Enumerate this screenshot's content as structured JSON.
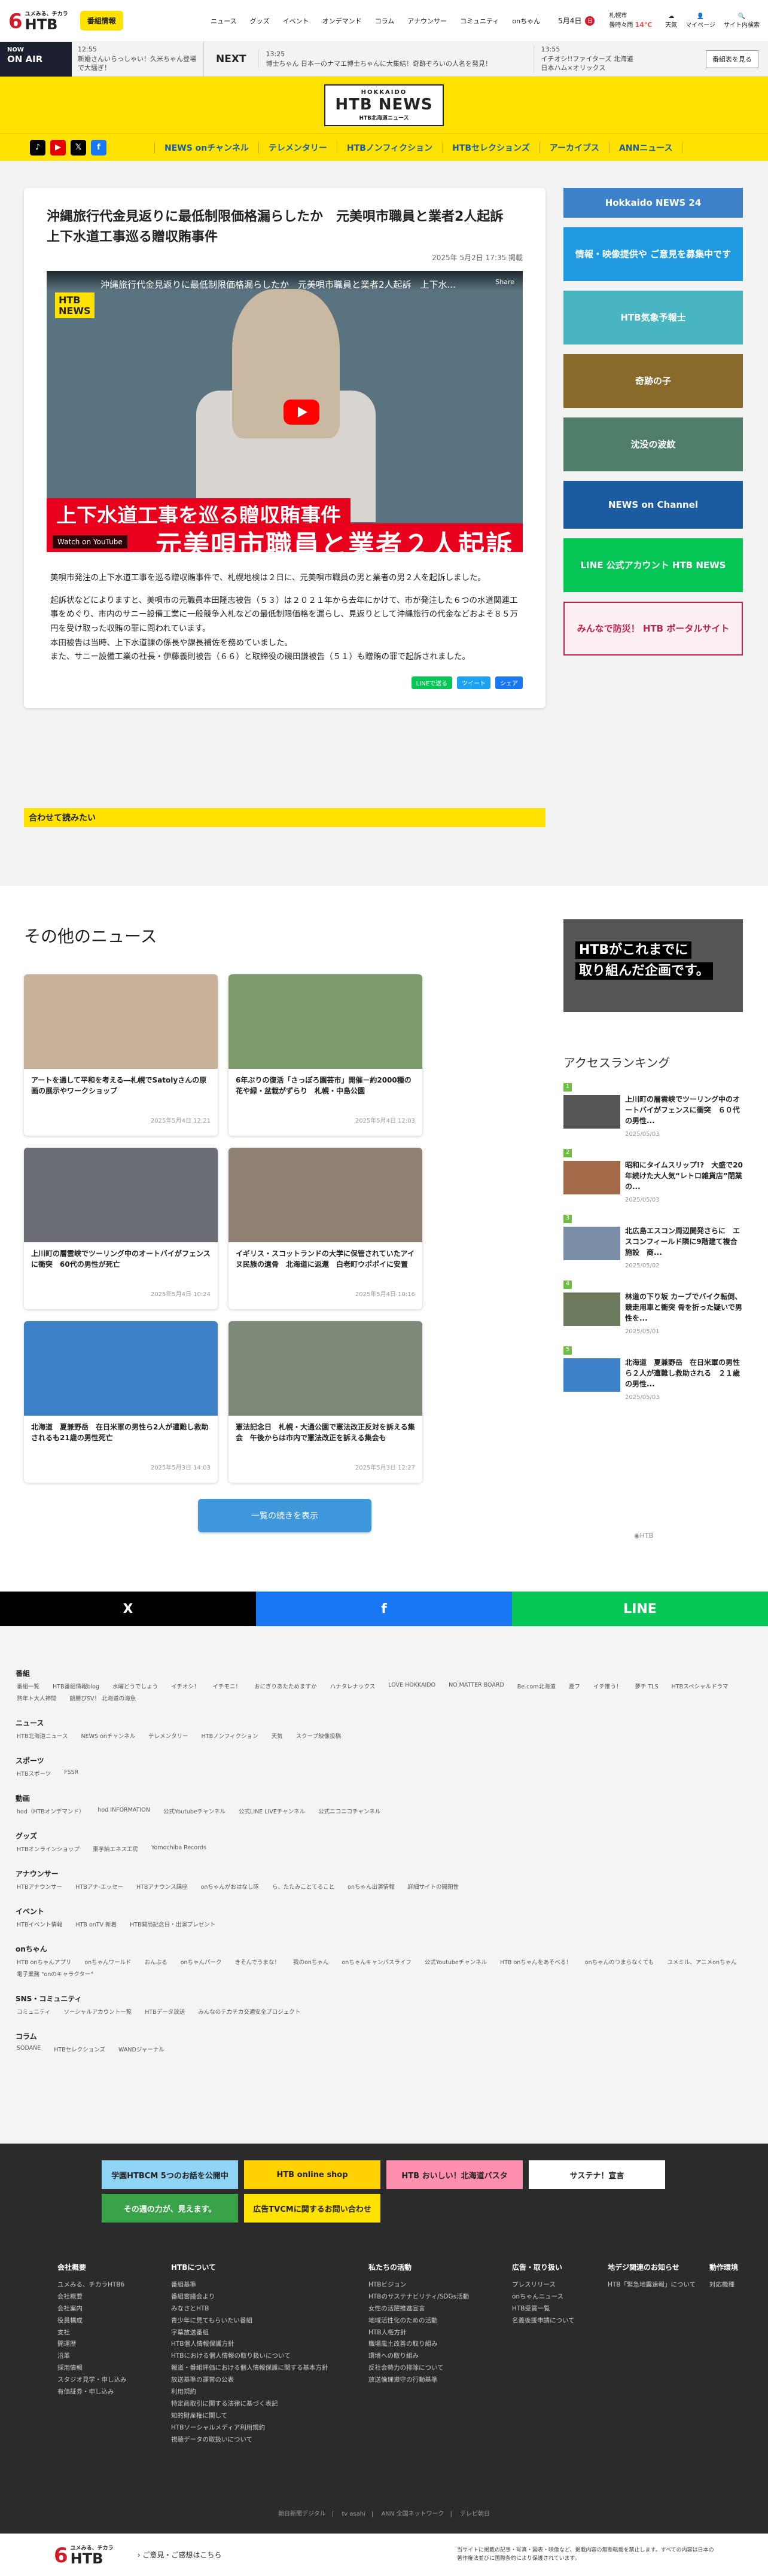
{
  "brand": {
    "logo_top": "ユメみる、チカラ",
    "logo_six": "6",
    "logo_htb": "HTB"
  },
  "header": {
    "login": "番組情報",
    "nav": [
      "ニュース",
      "グッズ",
      "イベント",
      "オンデマンド",
      "コラム",
      "アナウンサー",
      "コミュニティ",
      "onちゃん"
    ],
    "date": "5月4日",
    "date_badge": "日",
    "weather": {
      "place": "札幌市",
      "desc": "曇時々雨",
      "temp": "14℃"
    },
    "icons": [
      "天気",
      "マイページ",
      "サイト内検索"
    ]
  },
  "onair": {
    "now": "NOW",
    "on_air": "ON AIR",
    "now_time": "12:55",
    "now_title": "新婚さんいらっしゃい！久米ちゃん登場で大騒ぎ！",
    "next_label": "NEXT",
    "next_time": "13:25",
    "next_title": "博士ちゃん 日本一のナマエ博士ちゃんに大集結！奇跡ぞろいの人名を発見！",
    "next2_time": "13:55",
    "next2_title": "イチオシ!!ファイターズ 北海道日本ハム×オリックス",
    "guide": "番組表を見る"
  },
  "site": {
    "hokkaido": "HOKKAIDO",
    "name": "HTB NEWS",
    "sub": "HTB北海道ニュース"
  },
  "categories": [
    "NEWS onチャンネル",
    "テレメンタリー",
    "HTBノンフィクション",
    "HTBセレクションズ",
    "アーカイブス",
    "ANNニュース"
  ],
  "article": {
    "title": "沖縄旅行代金見返りに最低制限価格漏らしたか　元美唄市職員と業者2人起訴　上下水道工事巡る贈収賄事件",
    "date": "2025年 5月2日 17:35 掲載",
    "video_title": "沖縄旅行代金見返りに最低制限価格漏らしたか　元美唄市職員と業者2人起訴　上下水...",
    "video_band1": "上下水道工事を巡る贈収賄事件",
    "video_band2": "元美唄市職員と業者２人起訴",
    "share": "Share",
    "yt": "Watch on YouTube",
    "paragraphs": [
      "美唄市発注の上下水道工事を巡る贈収賄事件で、札幌地検は２日に、元美唄市職員の男と業者の男２人を起訴しました。",
      "起訴状などによりますと、美唄市の元職員本田隆志被告（５３）は２０２１年から去年にかけて、市が発注した６つの水道関連工事をめぐり、市内のサニー設備工業に一般競争入札などの最低制限価格を漏らし、見返りとして沖縄旅行の代金などおよそ８５万円を受け取った収賄の罪に問われています。\n本田被告は当時、上下水道課の係長や課長補佐を務めていました。\nまた、サニー設備工業の社長・伊藤義則被告（６６）と取締役の磯田謙被告（５１）も贈賄の罪で起訴されました。"
    ],
    "share_buttons": [
      "LINEで送る",
      "ツイート",
      "シェア"
    ]
  },
  "related": "合わせて読みたい",
  "rail_banners": [
    "Hokkaido NEWS 24",
    "情報・映像提供や ご意見を募集中です",
    "HTB気象予報士",
    "奇跡の子",
    "沈没の波紋",
    "NEWS on Channel",
    "LINE 公式アカウント HTB NEWS",
    "みんなで防災！ HTB ポータルサイト"
  ],
  "other": {
    "heading": "その他のニュース",
    "cards": [
      {
        "title": "アートを通して平和を考える―札幌でSatolyさんの原画の展示やワークショップ",
        "date": "2025年5月4日 12:21"
      },
      {
        "title": "6年ぶりの復活「さっぽろ園芸市」開催－約2000種の花や緑・盆栽がずらり　札幌・中島公園",
        "date": "2025年5月4日 12:03"
      },
      {
        "title": "上川町の層雲峡でツーリング中のオートバイがフェンスに衝突　60代の男性が死亡",
        "date": "2025年5月4日 10:24"
      },
      {
        "title": "イギリス・スコットランドの大学に保管されていたアイヌ民族の遺骨　北海道に返還　白老町ウポポイに安置",
        "date": "2025年5月4日 10:16"
      },
      {
        "title": "北海道　夏兼野岳　在日米軍の男性ら2人が遭難し救助されるも21歳の男性死亡",
        "date": "2025年5月3日 14:03"
      },
      {
        "title": "憲法記念日　札幌・大通公園で憲法改正反対を訴える集会　午後からは市内で憲法改正を訴える集会も",
        "date": "2025年5月3日 12:27"
      }
    ],
    "more": "一覧の続きを表示",
    "promo_line1": "HTBがこれまでに",
    "promo_line2": "取り組んだ企画です。",
    "ranking_title": "アクセスランキング",
    "ranking": [
      {
        "num": "1",
        "title": "上川町の層雲峡でツーリング中のオートバイがフェンスに衝突　６０代の男性...",
        "date": "2025/05/03"
      },
      {
        "num": "2",
        "title": "昭和にタイムスリップ!?　大盛で20年続けた大人気“レトロ雑貨店”閉業の...",
        "date": "2025/05/03"
      },
      {
        "num": "3",
        "title": "北広島エスコン周辺開発さらに　エスコンフィールド隣に9階建て複合施設　商...",
        "date": "2025/05/02"
      },
      {
        "num": "4",
        "title": "林道の下り坂 カーブでバイク転倒、競走用車と衝突 骨を折った疑いで男性を...",
        "date": "2025/05/01"
      },
      {
        "num": "5",
        "title": "北海道　夏兼野岳　在日米軍の男性ら２人が遭難し救助される　２１歳の男性...",
        "date": "2025/05/03"
      }
    ],
    "htb_mark": "HTB"
  },
  "sharebar": [
    "X",
    "f",
    "LINE"
  ],
  "sitemap": [
    {
      "title": "番組",
      "links": [
        "番組一覧",
        "HTB番組情報blog",
        "水曜どうでしょう",
        "イチオシ！",
        "イチモニ！",
        "おにぎりあたためますか",
        "ハナタレナックス",
        "LOVE HOKKAIDO",
        "NO MATTER BOARD",
        "Be.com北海道",
        "夏フ",
        "イチ推う！",
        "夢チ TLS",
        "HTBスペシャルドラマ",
        "熟年ト大人神間",
        "朗勝びSV！ 北海道の海魚"
      ]
    },
    {
      "title": "ニュース",
      "links": [
        "HTB北海道ニュース",
        "NEWS onチャンネル",
        "テレメンタリー",
        "HTBノンフィクション",
        "天気",
        "スクープ映像投稿"
      ]
    },
    {
      "title": "スポーツ",
      "links": [
        "HTBスポーツ",
        "FSSR"
      ]
    },
    {
      "title": "動画",
      "links": [
        "hod（HTBオンデマンド）",
        "hod INFORMATION",
        "公式Youtubeチャンネル",
        "公式LINE LIVEチャンネル",
        "公式ニコニコチャンネル"
      ]
    },
    {
      "title": "グッズ",
      "links": [
        "HTBオンラインショップ",
        "東芋納エネス工房",
        "Yomochiba Records"
      ]
    },
    {
      "title": "アナウンサー",
      "links": [
        "HTBアナウンサー",
        "HTBアナ-エッセー",
        "HTBアナウンス講座",
        "onちゃんがおはなし隊",
        "ら、たたみことてること",
        "onちゃん出演情報",
        "詳細サイトの開閉性"
      ]
    },
    {
      "title": "イベント",
      "links": [
        "HTBイベント情報",
        "HTB onTV 新着",
        "HTB開局記念日・出演プレゼント"
      ]
    },
    {
      "title": "onちゃん",
      "links": [
        "HTB onちゃんアプリ",
        "onちゃんワールド",
        "おんぶる",
        "onちゃんパーク",
        "きそんでうまな！",
        "我のonちゃん",
        "onちゃんキャンパスライフ",
        "公式Youtubeチャンネル",
        "HTB onちゃんをあそべる！",
        "onちゃんのつまらなくても",
        "ユメミル、アニメonちゃん",
        "電子業務 \"onのキャラクター\""
      ]
    },
    {
      "title": "SNS・コミュニティ",
      "links": [
        "コミュニティ",
        "ソーシャルアカウント一覧",
        "HTBデータ放送",
        "みんなのテカチカ交通安全プロジェクト"
      ]
    },
    {
      "title": "コラム",
      "links": [
        "SODANE",
        "HTBセレクションズ",
        "WANDジャーナル"
      ]
    }
  ],
  "footer": {
    "banners": [
      "学園HTBCM 5つのお話を公開中",
      "HTB online shop",
      "HTB おいしい！北海道バスタ",
      "サステナ！宣言",
      "その週の力が、見えます。",
      "広告TVCMに関するお問い合わせ",
      "",
      ""
    ],
    "cols": [
      {
        "title": "会社概要",
        "links": [
          "ユメみる、チカラHTB6",
          "会社概要",
          "会社案内",
          "役員構成",
          "支社",
          "開運歴",
          "沿革",
          "採用情報",
          "スタジオ見学・申し込み",
          "有価証券・申し込み"
        ]
      },
      {
        "title": "HTBについて",
        "links": [
          "番組基準",
          "番組審議会より",
          "みなさとHTB",
          "青少年に見てもらいたい番組",
          "字幕放送番組",
          "HTB個人情報保護方針",
          "HTBにおける個人情報の取り扱いについて",
          "報道・番組評価における個人情報保護に関する基本方針",
          "放送基準の運営の公表",
          "利用規約",
          "特定商取引に関する法律に基づく表記",
          "知的財産権に関して",
          "HTBソーシャルメディア利用規約",
          "視聴データの取扱いについて"
        ]
      },
      {
        "title": "私たちの活動",
        "links": [
          "HTBビジョン",
          "HTBのサステナビリティ/SDGs活動",
          "女性の活躍推進宣言",
          "地域活性化のための活動",
          "HTB人権方針",
          "職場風土改善の取り組み",
          "環境への取り組み",
          "反社会勢力の排除について",
          "放送倫理遵守の行動基準"
        ]
      },
      {
        "title": "広告・取り扱い",
        "links": [
          "プレスリリース",
          "onちゃんニュース",
          "HTB受賞一覧",
          "名義後援申請について"
        ]
      },
      {
        "title": "地デジ関連のお知らせ",
        "links": [
          "HTB「緊急地震速報」について"
        ]
      },
      {
        "title": "動作環境",
        "links": [
          "対応機種"
        ]
      }
    ],
    "bottom_links": [
      "朝日新聞デジタル",
      "tv asahi",
      "ANN 全国ネットワーク",
      "テレビ朝日"
    ],
    "contact": "ご意見・ご感想はこちら",
    "copyright_note": "当サイトに掲載の記事・写真・図表・映像など、掲載内容の無断転載を禁止します。すべての内容は日本の著作権法並びに国際条約により保護されています。"
  }
}
